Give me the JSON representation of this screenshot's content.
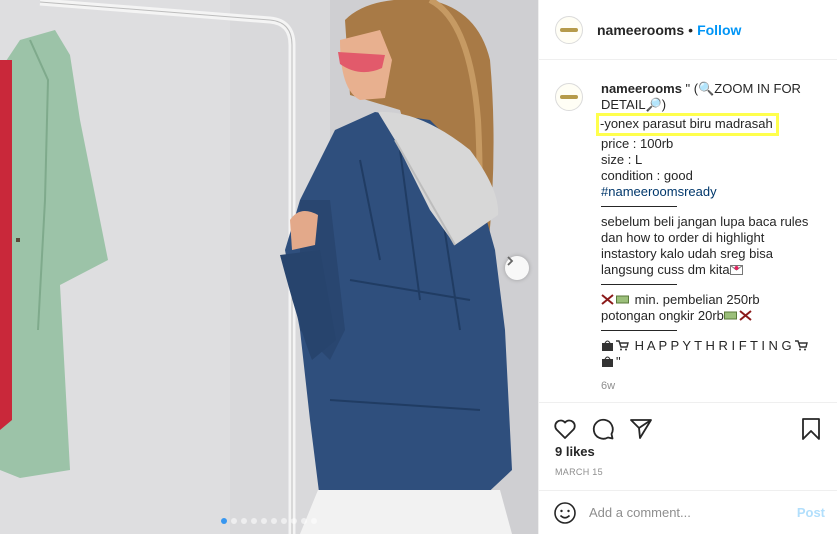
{
  "colors": {
    "follow": "#0095f6",
    "highlight_box": "#ffff4d",
    "hashtag": "#00376b",
    "muted": "#8e8e8e",
    "post_disabled": "#b2dffc",
    "carousel_active_dot": "#3897f0"
  },
  "header": {
    "username": "nameerooms",
    "separator": "•",
    "follow_label": "Follow"
  },
  "caption": {
    "username": "nameerooms",
    "line1": "\" (🔍ZOOM IN FOR",
    "line2": "DETAIL🔎)",
    "product": "-yonex parasut biru madrasah",
    "price": "price : 100rb",
    "size": "size : L",
    "condition": "condition : good",
    "hashtag": "#nameeroomsready",
    "rules": [
      "sebelum beli jangan lupa baca rules",
      "dan how to order di highlight",
      "instastory kalo udah sreg bisa",
      "langsung cuss dm kita"
    ],
    "min_purchase": "min. pembelian 250rb",
    "shipping_discount": "potongan ongkir 20rb",
    "happy_thrifting": "H A P P Y T H R I F T I N G",
    "closing_quote": "\"",
    "time": "6w"
  },
  "stats": {
    "likes": "9 likes",
    "date": "MARCH 15"
  },
  "comment": {
    "placeholder": "Add a comment...",
    "post_label": "Post"
  },
  "carousel": {
    "slide_count": 10,
    "active_index": 0
  },
  "icons": {
    "heart": "heart-icon",
    "comment": "comment-icon",
    "share": "share-icon",
    "save": "bookmark-icon",
    "emoji": "emoji-icon",
    "next": "chevron-right-icon"
  }
}
